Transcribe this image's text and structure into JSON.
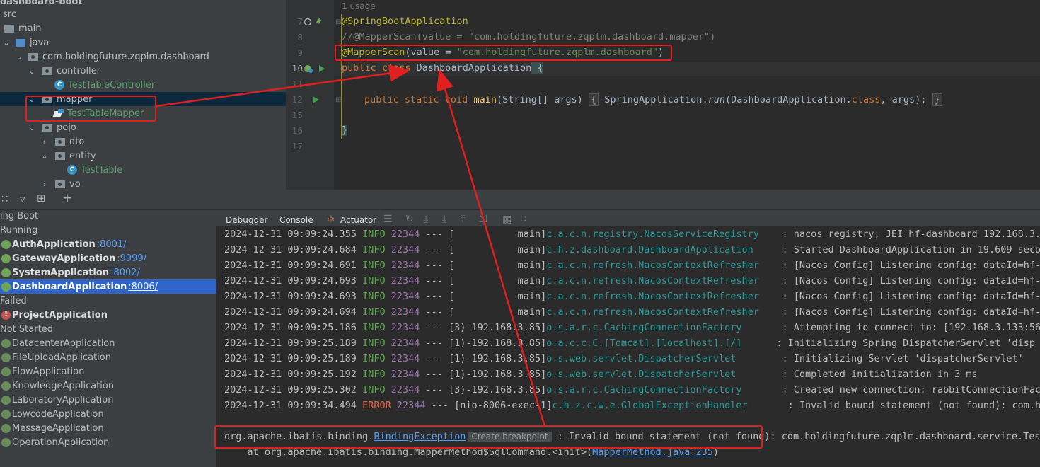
{
  "project": {
    "root_label": "dashboard-boot",
    "items": [
      {
        "label": "src"
      },
      {
        "label": "main"
      },
      {
        "label": "java"
      },
      {
        "label": "com.holdingfuture.zqplm.dashboard"
      },
      {
        "label": "controller"
      },
      {
        "label": "TestTableController"
      },
      {
        "label": "mapper"
      },
      {
        "label": "TestTableMapper"
      },
      {
        "label": "pojo"
      },
      {
        "label": "dto"
      },
      {
        "label": "entity"
      },
      {
        "label": "TestTable"
      },
      {
        "label": "vo"
      }
    ]
  },
  "editor": {
    "usage_hint": "1 usage",
    "line_numbers": [
      "7",
      "8",
      "9",
      "10",
      "11",
      "12",
      "15",
      "16",
      "17"
    ],
    "lines": {
      "l7_annotation": "@SpringBootApplication",
      "l8_comment": "//@MapperScan(value = \"com.holdingfuture.zqplm.dashboard.mapper\")",
      "l9_annotation": "@MapperScan",
      "l9_mid": "(value = ",
      "l9_string": "\"com.holdingfuture.zqplm.dashboard\"",
      "l9_end": ")",
      "l10_kw": "public class ",
      "l10_name": "DashboardApplication",
      "l10_brace": " {",
      "l12_kw": "public static void ",
      "l12_fn": "main",
      "l12_args": "(String[] args) ",
      "l12_fold_open": "{",
      "l12_body_a": " SpringApplication.",
      "l12_run": "run",
      "l12_body_b": "(DashboardApplication.",
      "l12_class_kw": "class",
      "l12_body_c": ", args);",
      "l12_fold_close": "}",
      "l16_brace": "}"
    }
  },
  "services": {
    "groups": {
      "spring_boot": "ing Boot",
      "running": "Running",
      "failed": "Failed",
      "not_started": "Not Started"
    },
    "running_apps": [
      {
        "name": "AuthApplication",
        "port": ":8001/"
      },
      {
        "name": "GatewayApplication",
        "port": ":9999/"
      },
      {
        "name": "SystemApplication",
        "port": ":8002/"
      },
      {
        "name": "DashboardApplication",
        "port": ":8006/"
      }
    ],
    "failed_apps": [
      {
        "name": "ProjectApplication"
      }
    ],
    "not_started_apps": [
      {
        "name": "DatacenterApplication"
      },
      {
        "name": "FileUploadApplication"
      },
      {
        "name": "FlowApplication"
      },
      {
        "name": "KnowledgeApplication"
      },
      {
        "name": "LaboratoryApplication"
      },
      {
        "name": "LowcodeApplication"
      },
      {
        "name": "MessageApplication"
      },
      {
        "name": "OperationApplication"
      }
    ]
  },
  "tabs": {
    "debugger": "Debugger",
    "console": "Console",
    "actuator": "Actuator"
  },
  "console": {
    "logs": [
      {
        "ts": "2024-12-31 09:09:24.355",
        "level": "INFO",
        "pid": "22344",
        "sep": " --- [",
        "thread": "           main]",
        "logger": "c.a.c.n.registry.NacosServiceRegistry   ",
        "msg": " : nacos registry, JEI hf-dashboard 192.168.3."
      },
      {
        "ts": "2024-12-31 09:09:24.684",
        "level": "INFO",
        "pid": "22344",
        "sep": " --- [",
        "thread": "           main]",
        "logger": "c.h.z.dashboard.DashboardApplication    ",
        "msg": " : Started DashboardApplication in 19.609 seco"
      },
      {
        "ts": "2024-12-31 09:09:24.691",
        "level": "INFO",
        "pid": "22344",
        "sep": " --- [",
        "thread": "           main]",
        "logger": "c.a.c.n.refresh.NacosContextRefresher   ",
        "msg": " : [Nacos Config] Listening config: dataId=hf-"
      },
      {
        "ts": "2024-12-31 09:09:24.693",
        "level": "INFO",
        "pid": "22344",
        "sep": " --- [",
        "thread": "           main]",
        "logger": "c.a.c.n.refresh.NacosContextRefresher   ",
        "msg": " : [Nacos Config] Listening config: dataId=hf-"
      },
      {
        "ts": "2024-12-31 09:09:24.693",
        "level": "INFO",
        "pid": "22344",
        "sep": " --- [",
        "thread": "           main]",
        "logger": "c.a.c.n.refresh.NacosContextRefresher   ",
        "msg": " : [Nacos Config] Listening config: dataId=hf-"
      },
      {
        "ts": "2024-12-31 09:09:24.694",
        "level": "INFO",
        "pid": "22344",
        "sep": " --- [",
        "thread": "           main]",
        "logger": "c.a.c.n.refresh.NacosContextRefresher   ",
        "msg": " : [Nacos Config] Listening config: dataId=hf-"
      },
      {
        "ts": "2024-12-31 09:09:25.186",
        "level": "INFO",
        "pid": "22344",
        "sep": " --- [",
        "thread": "3)-192.168.3.85]",
        "logger": "o.s.a.r.c.CachingConnectionFactory      ",
        "msg": " : Attempting to connect to: [192.168.3.133:56"
      },
      {
        "ts": "2024-12-31 09:09:25.189",
        "level": "INFO",
        "pid": "22344",
        "sep": " --- [",
        "thread": "1)-192.168.3.85]",
        "logger": "o.a.c.c.C.[Tomcat].[localhost].[/]     ",
        "msg": " : Initializing Spring DispatcherServlet 'disp"
      },
      {
        "ts": "2024-12-31 09:09:25.189",
        "level": "INFO",
        "pid": "22344",
        "sep": " --- [",
        "thread": "1)-192.168.3.85]",
        "logger": "o.s.web.servlet.DispatcherServlet       ",
        "msg": " : Initializing Servlet 'dispatcherServlet'"
      },
      {
        "ts": "2024-12-31 09:09:25.192",
        "level": "INFO",
        "pid": "22344",
        "sep": " --- [",
        "thread": "1)-192.168.3.85]",
        "logger": "o.s.web.servlet.DispatcherServlet       ",
        "msg": " : Completed initialization in 3 ms"
      },
      {
        "ts": "2024-12-31 09:09:25.302",
        "level": "INFO",
        "pid": "22344",
        "sep": " --- [",
        "thread": "3)-192.168.3.85]",
        "logger": "o.s.a.r.c.CachingConnectionFactory      ",
        "msg": " : Created new connection: rabbitConnectionFac"
      },
      {
        "ts": "2024-12-31 09:09:34.494",
        "level": "ERROR",
        "pid": "22344",
        "sep": " --- [",
        "thread": "nio-8006-exec-1]",
        "logger": "c.h.z.c.w.e.GlobalExceptionHandler      ",
        "msg": " : Invalid bound statement (not found): com.ho"
      }
    ],
    "exception_prefix": "org.apache.ibatis.binding.",
    "exception_link": "BindingException",
    "breakpoint_hint": "Create breakpoint",
    "exception_msg": " : Invalid bound statement (not found):",
    "exception_tail": " com.holdingfuture.zqplm.dashboard.service.TestTa",
    "stack_prefix": "    at org.apache.ibatis.binding.MapperMethod$SqlCommand.<init>(",
    "stack_link": "MapperMethod.java:235",
    "stack_suffix": ")"
  },
  "colors": {
    "annotation_box": "#e02020",
    "arrow": "#e02020"
  }
}
